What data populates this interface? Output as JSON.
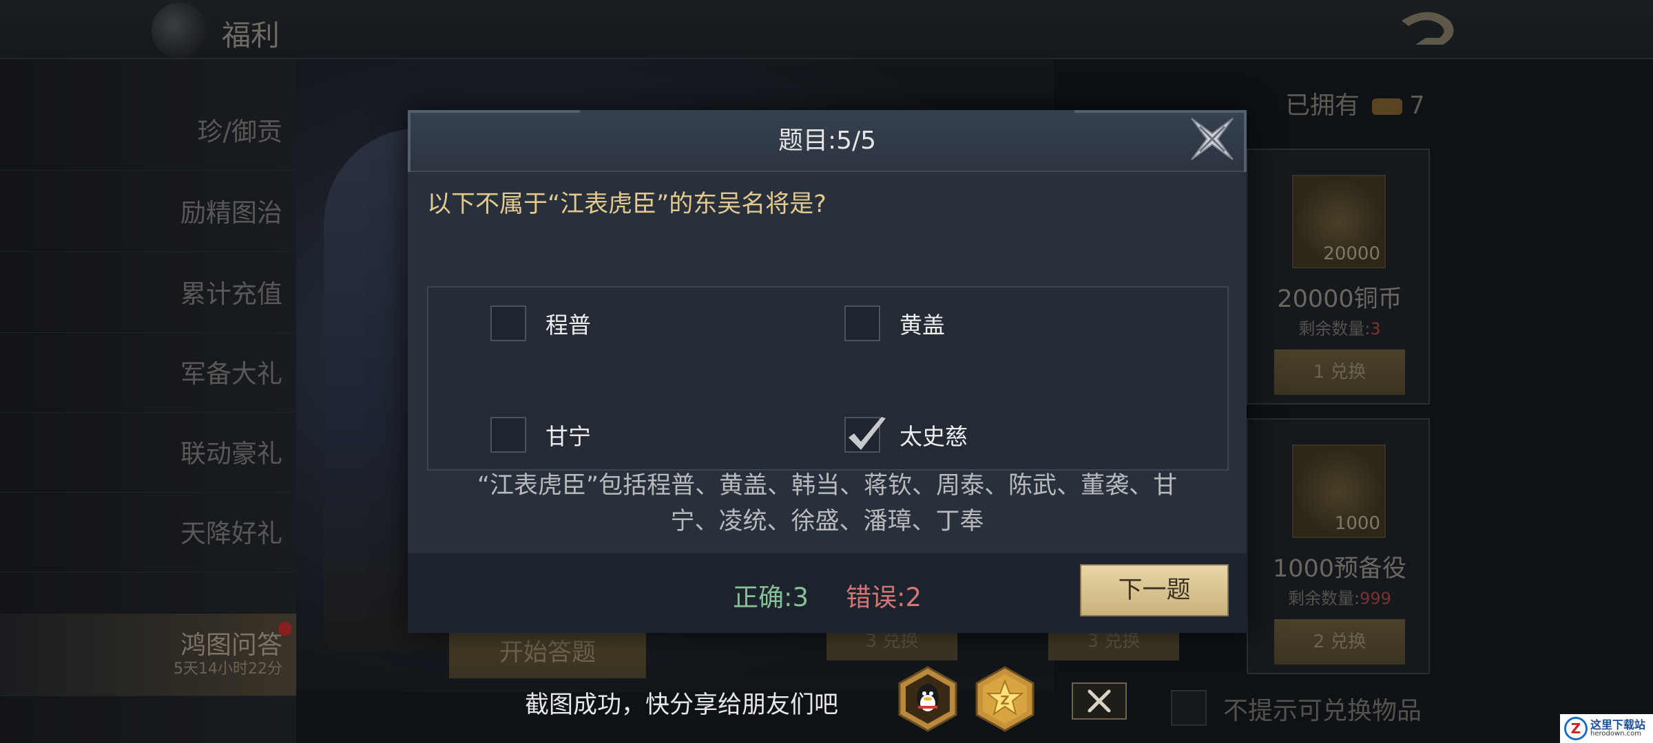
{
  "header": {
    "title": "福利"
  },
  "sidebar": {
    "items": [
      {
        "label": "珍/御贡"
      },
      {
        "label": "励精图治"
      },
      {
        "label": "累计充值"
      },
      {
        "label": "军备大礼"
      },
      {
        "label": "联动豪礼"
      },
      {
        "label": "天降好礼"
      },
      {
        "label": "鸿图问答",
        "timer": "5天14小时22分"
      }
    ]
  },
  "page": {
    "owned_label": "已拥有",
    "owned_count": "7",
    "start_button": "开始答题",
    "hide_option_label": "不提示可兑换物品"
  },
  "cards": [
    {
      "item_qty": "20000",
      "item_name": "20000铜币",
      "remain_label": "剩余数量:",
      "remain_value": "3",
      "cost": "1",
      "exchange_label": "兑换"
    },
    {
      "item_qty": "1000",
      "item_name": "1000预备役",
      "remain_label": "剩余数量:",
      "remain_value": "999",
      "cost": "2",
      "exchange_label": "兑换"
    }
  ],
  "mini_exchanges": [
    {
      "cost": "3",
      "label": "兑换"
    },
    {
      "cost": "3",
      "label": "兑换"
    }
  ],
  "dialog": {
    "title": "题目:5/5",
    "question": "以下不属于“江表虎臣”的东吴名将是?",
    "options": [
      {
        "label": "程普",
        "checked": false
      },
      {
        "label": "黄盖",
        "checked": false
      },
      {
        "label": "甘宁",
        "checked": false
      },
      {
        "label": "太史慈",
        "checked": true
      }
    ],
    "explanation_line1": "“江表虎臣”包括程普、黄盖、韩当、蒋钦、周泰、陈武、董袭、甘",
    "explanation_line2": "宁、凌统、徐盛、潘璋、丁奉",
    "correct_text": "正确:3",
    "wrong_text": "错误:2",
    "next_button": "下一题"
  },
  "share": {
    "message": "截图成功，快分享给朋友们吧",
    "icons": [
      "qq-icon",
      "qzone-icon"
    ]
  },
  "watermark": {
    "text_cn": "这里下载站",
    "text_en": "herodown.com"
  },
  "colors": {
    "accent_gold": "#e4c98f",
    "correct_green": "#86c098",
    "wrong_red": "#d47676",
    "button_gold": "#d8c28e"
  }
}
